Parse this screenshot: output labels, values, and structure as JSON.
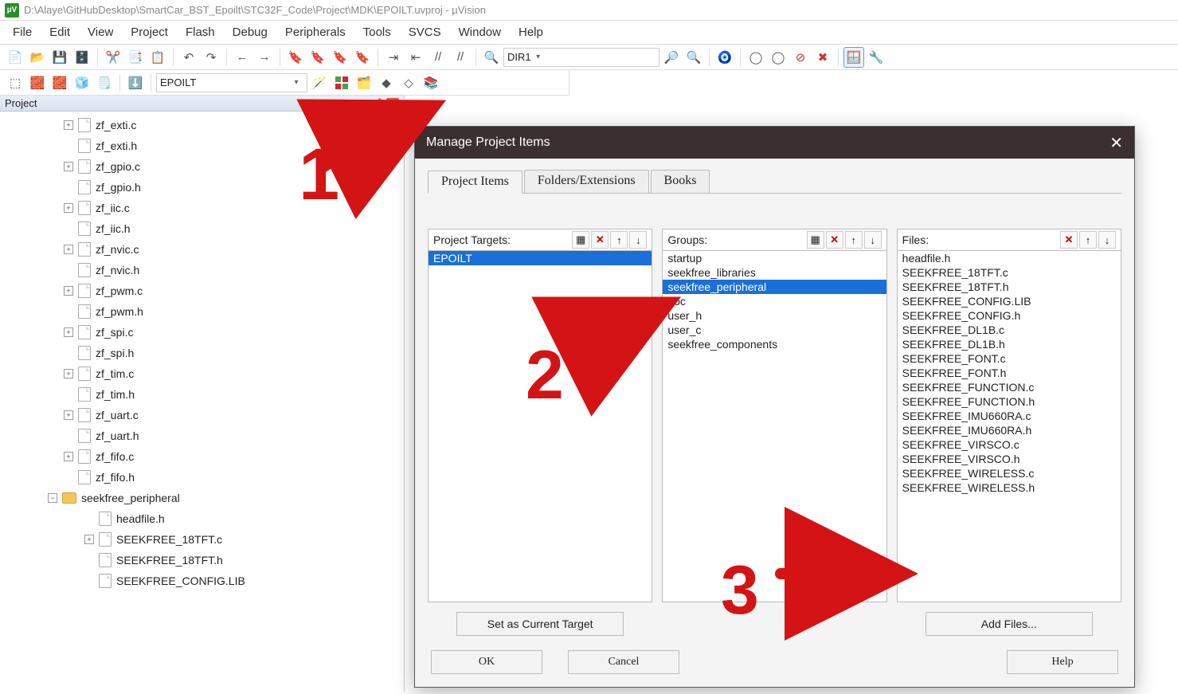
{
  "window": {
    "title": "D:\\Alaye\\GitHubDesktop\\SmartCar_BST_Epoilt\\STC32F_Code\\Project\\MDK\\EPOILT.uvproj - µVision"
  },
  "menu": {
    "items": [
      "File",
      "Edit",
      "View",
      "Project",
      "Flash",
      "Debug",
      "Peripherals",
      "Tools",
      "SVCS",
      "Window",
      "Help"
    ]
  },
  "toolbar1": {
    "find_combo": "DIR1"
  },
  "toolbar2": {
    "target_combo": "EPOILT"
  },
  "project_pane": {
    "title": "Project",
    "items": [
      {
        "label": "zf_exti.c",
        "toggle": "plus",
        "kind": "file"
      },
      {
        "label": "zf_exti.h",
        "toggle": "none",
        "kind": "file"
      },
      {
        "label": "zf_gpio.c",
        "toggle": "plus",
        "kind": "file"
      },
      {
        "label": "zf_gpio.h",
        "toggle": "none",
        "kind": "file"
      },
      {
        "label": "zf_iic.c",
        "toggle": "plus",
        "kind": "file"
      },
      {
        "label": "zf_iic.h",
        "toggle": "none",
        "kind": "file"
      },
      {
        "label": "zf_nvic.c",
        "toggle": "plus",
        "kind": "file"
      },
      {
        "label": "zf_nvic.h",
        "toggle": "none",
        "kind": "file"
      },
      {
        "label": "zf_pwm.c",
        "toggle": "plus",
        "kind": "file"
      },
      {
        "label": "zf_pwm.h",
        "toggle": "none",
        "kind": "file"
      },
      {
        "label": "zf_spi.c",
        "toggle": "plus",
        "kind": "file"
      },
      {
        "label": "zf_spi.h",
        "toggle": "none",
        "kind": "file"
      },
      {
        "label": "zf_tim.c",
        "toggle": "plus",
        "kind": "file"
      },
      {
        "label": "zf_tim.h",
        "toggle": "none",
        "kind": "file"
      },
      {
        "label": "zf_uart.c",
        "toggle": "plus",
        "kind": "file"
      },
      {
        "label": "zf_uart.h",
        "toggle": "none",
        "kind": "file"
      },
      {
        "label": "zf_fifo.c",
        "toggle": "plus",
        "kind": "file"
      },
      {
        "label": "zf_fifo.h",
        "toggle": "none",
        "kind": "file"
      },
      {
        "label": "seekfree_peripheral",
        "toggle": "minus",
        "kind": "folder"
      },
      {
        "label": "headfile.h",
        "toggle": "none",
        "kind": "file",
        "indent": true
      },
      {
        "label": "SEEKFREE_18TFT.c",
        "toggle": "plus",
        "kind": "file",
        "indent": true
      },
      {
        "label": "SEEKFREE_18TFT.h",
        "toggle": "none",
        "kind": "file",
        "indent": true
      },
      {
        "label": "SEEKFREE_CONFIG.LIB",
        "toggle": "none",
        "kind": "file",
        "indent": true
      }
    ]
  },
  "dialog": {
    "title": "Manage Project Items",
    "tabs": [
      "Project Items",
      "Folders/Extensions",
      "Books"
    ],
    "active_tab": 0,
    "col_targets": {
      "header": "Project Targets:",
      "rows": [
        "EPOILT"
      ],
      "selected": 0,
      "button": "Set as Current Target"
    },
    "col_groups": {
      "header": "Groups:",
      "rows": [
        "startup",
        "seekfree_libraries",
        "seekfree_peripheral",
        "doc",
        "user_h",
        "user_c",
        "seekfree_components"
      ],
      "selected": 2
    },
    "col_files": {
      "header": "Files:",
      "rows": [
        "headfile.h",
        "SEEKFREE_18TFT.c",
        "SEEKFREE_18TFT.h",
        "SEEKFREE_CONFIG.LIB",
        "SEEKFREE_CONFIG.h",
        "SEEKFREE_DL1B.c",
        "SEEKFREE_DL1B.h",
        "SEEKFREE_FONT.c",
        "SEEKFREE_FONT.h",
        "SEEKFREE_FUNCTION.c",
        "SEEKFREE_FUNCTION.h",
        "SEEKFREE_IMU660RA.c",
        "SEEKFREE_IMU660RA.h",
        "SEEKFREE_VIRSCO.c",
        "SEEKFREE_VIRSCO.h",
        "SEEKFREE_WIRELESS.c",
        "SEEKFREE_WIRELESS.h"
      ],
      "button": "Add Files..."
    },
    "footer": {
      "ok": "OK",
      "cancel": "Cancel",
      "help": "Help"
    }
  },
  "annotations": {
    "one": "1",
    "two": "2",
    "three": "3"
  }
}
